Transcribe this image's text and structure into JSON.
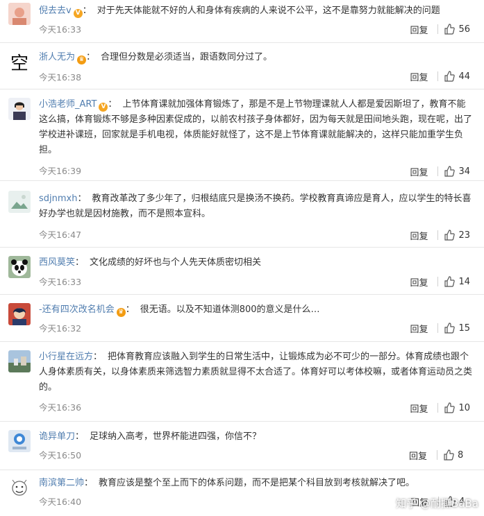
{
  "comments": [
    {
      "user": "倪去去v",
      "badge": "v",
      "text": "对于先天体能就不好的人和身体有疾病的人来说不公平，这不是靠努力就能解决的问题",
      "time": "今天16:33",
      "reply": "回复",
      "likes": "56"
    },
    {
      "user": "浙人无为",
      "badge": "crown",
      "text": "合理但分数是必须适当，跟语数同分过了。",
      "time": "今天16:38",
      "reply": "回复",
      "likes": "44"
    },
    {
      "user": "小浩老师_ART",
      "badge": "v",
      "text": "上节体育课就加强体育锻炼了，那是不是上节物理课就人人都是爱因斯坦了，教育不能这么搞，体育锻炼不够是多种因素促成的，以前农村孩子身体都好，因为每天就是田间地头跑，现在呢，出了学校进补课班，回家就是手机电视，体质能好就怪了，这不是上节体育课就能解决的，这样只能加重学生负担。",
      "time": "今天16:39",
      "reply": "回复",
      "likes": "34"
    },
    {
      "user": "sdjnmxh",
      "badge": "",
      "text": "教育改革改了多少年了，归根结底只是换汤不换药。学校教育真谛应是育人，应以学生的特长喜好办学也就是因材施教，而不是照本宣科。",
      "time": "今天16:47",
      "reply": "回复",
      "likes": "23"
    },
    {
      "user": "西风莫笑",
      "badge": "",
      "text": "文化成绩的好坏也与个人先天体质密切相关",
      "time": "今天16:33",
      "reply": "回复",
      "likes": "14"
    },
    {
      "user": "-还有四次改名机会",
      "badge": "crown",
      "text": "很无语。以及不知道体测800的意义是什么…",
      "time": "今天16:32",
      "reply": "回复",
      "likes": "15"
    },
    {
      "user": "小行星在远方",
      "badge": "",
      "text": "把体育教育应该融入到学生的日常生活中，让锻炼成为必不可少的一部分。体育成绩也跟个人身体素质有关，以身体素质来筛选智力素质就显得不太合适了。体育好可以考体校嘛，或者体育运动员之类的。",
      "time": "今天16:36",
      "reply": "回复",
      "likes": "10"
    },
    {
      "user": "诡异单刀",
      "badge": "",
      "text": "足球纳入高考，世界杯能进四强，你信不？",
      "time": "今天16:50",
      "reply": "回复",
      "likes": "8"
    },
    {
      "user": "南滨第二帅",
      "badge": "",
      "text": "教育应该是整个至上而下的体系问题，而不是把某个科目放到考核就解决了吧。",
      "time": "今天16:40",
      "reply": "回复",
      "likes": "4"
    }
  ],
  "watermark": "知乎 @耐撕BaBa",
  "colors": {
    "username": "#507daf",
    "time": "#8a8a8a",
    "divider": "#e6e6e6"
  }
}
